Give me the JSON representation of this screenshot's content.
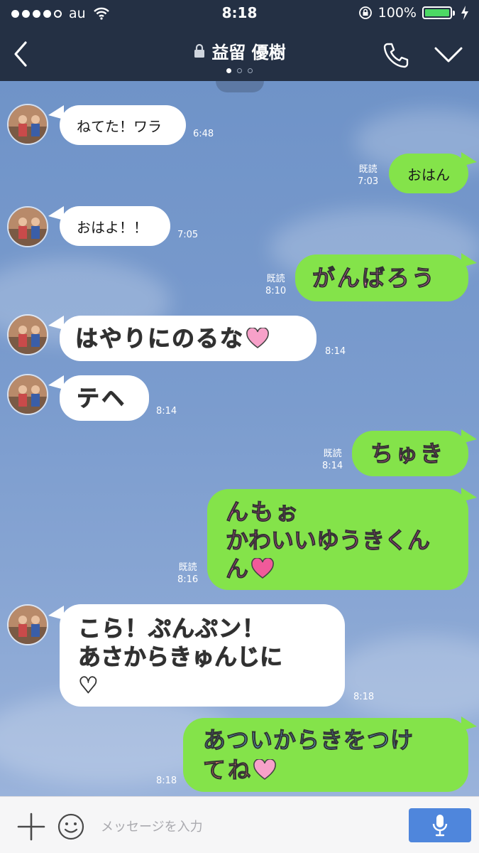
{
  "status_bar": {
    "carrier": "au",
    "time": "8:18",
    "battery_percent": "100%",
    "signal_bars_filled": 4,
    "signal_bars_total": 5,
    "icons": [
      "wifi-icon",
      "rotation-lock-icon",
      "battery-icon",
      "charging-bolt-icon"
    ]
  },
  "header": {
    "title": "益留 優樹",
    "title_icon": "lock-icon",
    "page_dots_total": 3,
    "page_dot_active": 1,
    "back_icon": "chevron-left-icon",
    "call_icon": "phone-icon",
    "menu_icon": "chevron-down-icon",
    "bg_color": "#243044"
  },
  "chat": {
    "incoming_bg": "#ffffff",
    "outgoing_bg": "#84e34a",
    "read_label": "既読",
    "messages": [
      {
        "dir": "in",
        "text": "ねてた！ワラ",
        "time": "6:48"
      },
      {
        "dir": "out",
        "text": "おはん",
        "time": "7:03",
        "read": "既読"
      },
      {
        "dir": "in",
        "text": "おはよ！！",
        "time": "7:05"
      },
      {
        "dir": "out",
        "text": "がんばろう",
        "time": "8:10",
        "read": "既読",
        "style": "deco"
      },
      {
        "dir": "in",
        "text": "はやりにのるな",
        "time": "8:14",
        "style": "deco",
        "emoji": "heart"
      },
      {
        "dir": "in",
        "text": "テヘ",
        "time": "8:14",
        "style": "deco"
      },
      {
        "dir": "out",
        "text": "ちゅき",
        "time": "8:14",
        "read": "既読",
        "style": "deco"
      },
      {
        "dir": "out",
        "lines": [
          "んもぉ",
          "かわいいゆうきくん",
          "ん"
        ],
        "time": "8:16",
        "read": "既読",
        "style": "deco",
        "emoji": "heart"
      },
      {
        "dir": "in",
        "lines": [
          "こら！ぷんぷン！",
          "あさからきゅんじに",
          "♡"
        ],
        "time": "8:18",
        "style": "deco"
      },
      {
        "dir": "out",
        "lines": [
          "あついからきをつけ",
          "てね"
        ],
        "time": "8:18",
        "style": "deco",
        "emoji": "heart"
      }
    ]
  },
  "input_bar": {
    "placeholder": "メッセージを入力",
    "value": "",
    "plus_icon": "plus-icon",
    "emoji_icon": "smiley-icon",
    "mic_icon": "microphone-icon",
    "mic_bg": "#4f86dc"
  }
}
